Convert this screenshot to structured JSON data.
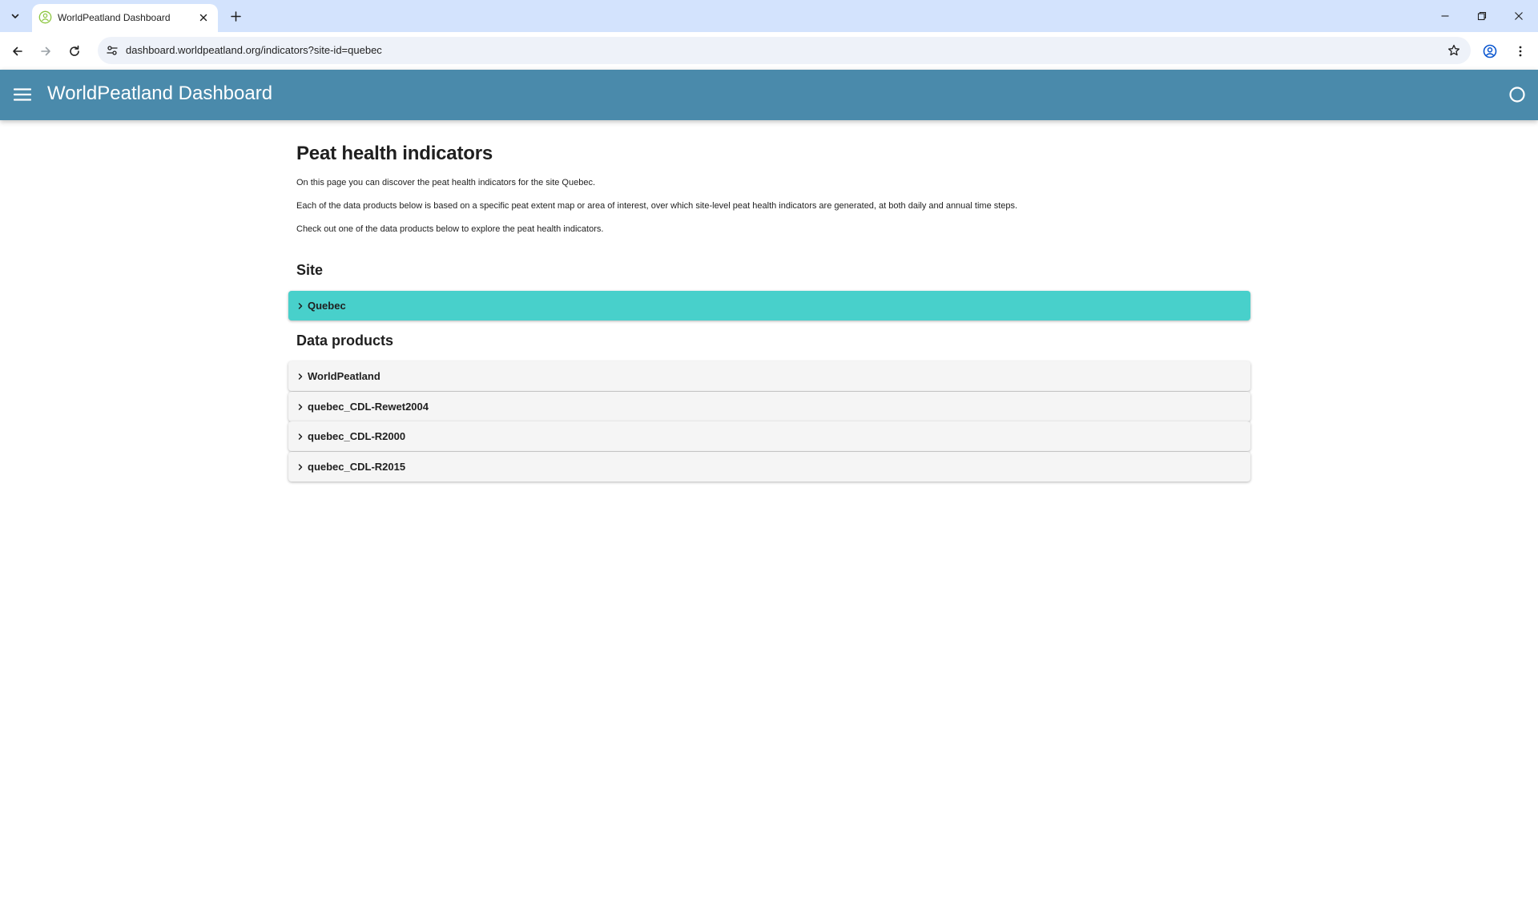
{
  "browser": {
    "tab_title": "WorldPeatland Dashboard",
    "url": "dashboard.worldpeatland.org/indicators?site-id=quebec"
  },
  "app": {
    "title": "WorldPeatland Dashboard"
  },
  "page": {
    "title": "Peat health indicators",
    "paragraphs": [
      "On this page you can discover the peat health indicators for the site Quebec.",
      "Each of the data products below is based on a specific peat extent map or area of interest, over which site-level peat health indicators are generated, at both daily and annual time steps.",
      "Check out one of the data products below to explore the peat health indicators."
    ],
    "site_heading": "Site",
    "site_item": "Quebec",
    "products_heading": "Data products",
    "products": [
      "WorldPeatland",
      "quebec_CDL-Rewet2004",
      "quebec_CDL-R2000",
      "quebec_CDL-R2015"
    ]
  },
  "colors": {
    "appbar": "#4a8aab",
    "site_accordion": "#48d0cb",
    "product_accordion": "#f5f5f5",
    "tabstrip": "#d3e3fd"
  },
  "icons": {
    "tab_search": "chevron-down-icon",
    "favicon": "worldpeatland-favicon-icon",
    "tab_close": "close-icon",
    "new_tab": "plus-icon",
    "back": "arrow-left-icon",
    "forward": "arrow-right-icon",
    "reload": "reload-icon",
    "site_info": "tune-icon",
    "bookmark": "star-icon",
    "profile": "profile-icon",
    "more": "kebab-menu-icon",
    "menu": "hamburger-icon",
    "status": "circle-icon",
    "accordion": "chevron-right-icon"
  }
}
